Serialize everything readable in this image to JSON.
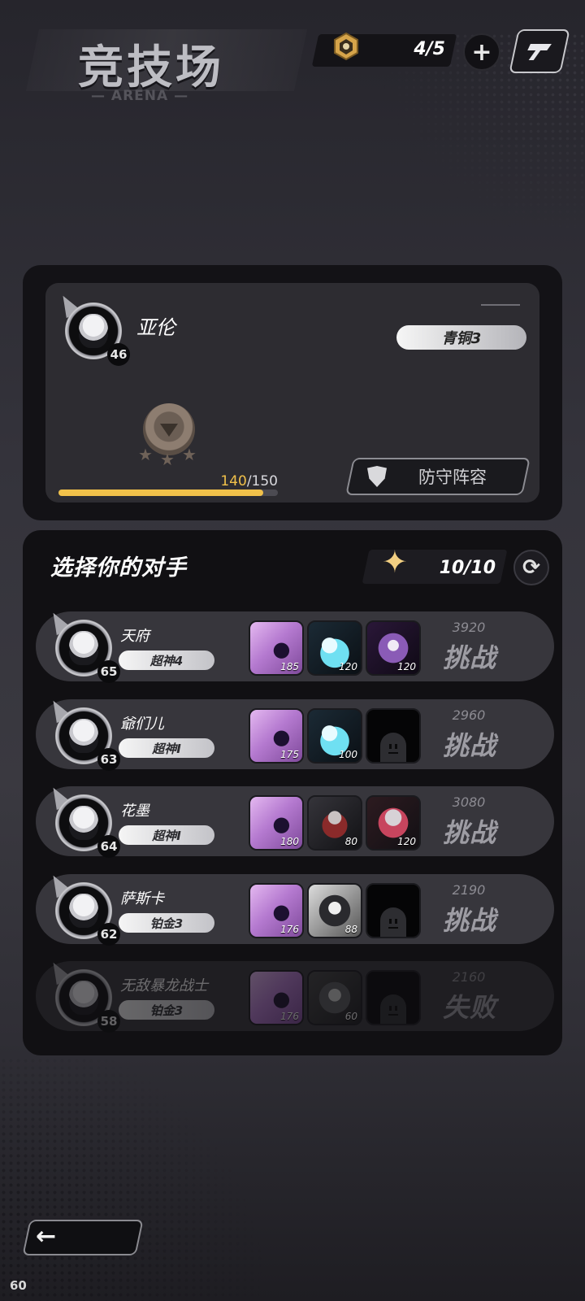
{
  "header": {
    "title": "竞技场",
    "subtitle": "— ARENA —",
    "tickets": "4/5",
    "add_symbol": "+"
  },
  "player": {
    "name": "亚伦",
    "level": "46",
    "tier": "青铜3",
    "progress_current": "140",
    "progress_total": "/150",
    "progress_fraction": 0.933,
    "defense_label": "防守阵容",
    "medal_stars": 3
  },
  "opponents_section": {
    "title": "选择你的对手",
    "refresh_count": "10/10"
  },
  "opponents": [
    {
      "name": "天府",
      "level": "65",
      "tier": "超神4",
      "score": "3920",
      "action": "挑战",
      "team": [
        {
          "lv": "185",
          "style": "c-purple"
        },
        {
          "lv": "120",
          "style": "c-cyan"
        },
        {
          "lv": "120",
          "style": "c-darkpurple"
        }
      ]
    },
    {
      "name": "爺们儿",
      "level": "63",
      "tier": "超神I",
      "score": "2960",
      "action": "挑战",
      "team": [
        {
          "lv": "175",
          "style": "c-purple"
        },
        {
          "lv": "100",
          "style": "c-cyan"
        },
        {
          "lv": "",
          "style": "c-empty"
        }
      ]
    },
    {
      "name": "花墨",
      "level": "64",
      "tier": "超神I",
      "score": "3080",
      "action": "挑战",
      "team": [
        {
          "lv": "180",
          "style": "c-purple"
        },
        {
          "lv": "80",
          "style": "c-dark"
        },
        {
          "lv": "120",
          "style": "c-red"
        }
      ]
    },
    {
      "name": "萨斯卡",
      "level": "62",
      "tier": "铂金3",
      "score": "2190",
      "action": "挑战",
      "team": [
        {
          "lv": "176",
          "style": "c-purple"
        },
        {
          "lv": "88",
          "style": "c-black"
        },
        {
          "lv": "",
          "style": "c-empty"
        }
      ]
    },
    {
      "name": "无敌暴龙战士",
      "level": "58",
      "tier": "铂金3",
      "score": "2160",
      "action": "失败",
      "team": [
        {
          "lv": "176",
          "style": "c-purple"
        },
        {
          "lv": "60",
          "style": "c-gray"
        },
        {
          "lv": "",
          "style": "c-empty"
        }
      ]
    }
  ],
  "footer": {
    "back_symbol": "←",
    "fps": "60"
  },
  "colors": {
    "accent_gold": "#f1c14a",
    "panel": "#131216",
    "row": "#37363c"
  },
  "icons": [
    "ticket-icon",
    "plus-icon",
    "rank-icon",
    "shield-icon",
    "star-icon",
    "refresh-icon",
    "back-arrow-icon"
  ]
}
